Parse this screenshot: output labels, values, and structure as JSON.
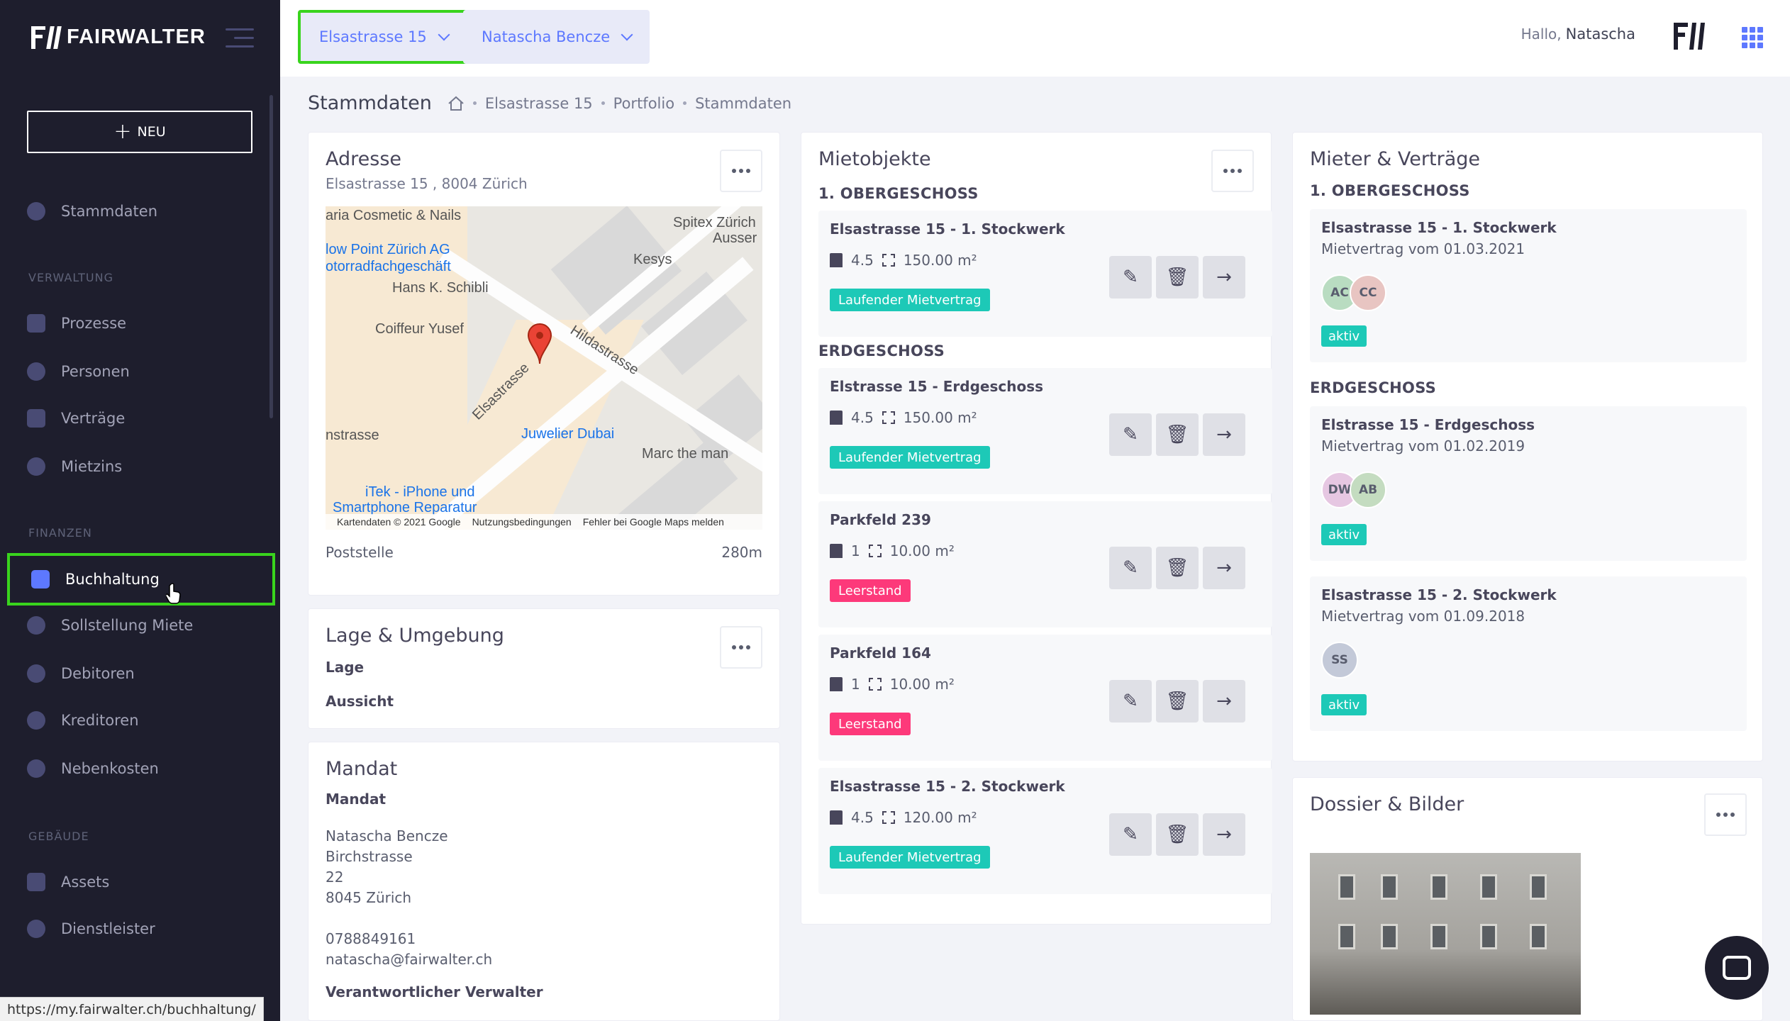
{
  "brand": "FAIRWALTER",
  "sidebar": {
    "new_label": "NEU",
    "top_item": "Stammdaten",
    "sections": [
      {
        "label": "VERWALTUNG",
        "items": [
          "Prozesse",
          "Personen",
          "Verträge",
          "Mietzins"
        ]
      },
      {
        "label": "FINANZEN",
        "items": [
          "Buchhaltung",
          "Sollstellung Miete",
          "Debitoren",
          "Kreditoren",
          "Nebenkosten"
        ]
      },
      {
        "label": "GEBÄUDE",
        "items": [
          "Assets",
          "Dienstleister"
        ]
      }
    ],
    "active_item": "Buchhaltung"
  },
  "status_url": "https://my.fairwalter.ch/buchhaltung/",
  "topbar": {
    "property_select": "Elsastrasse 15",
    "owner_select": "Natascha Bencze",
    "greeting": "Hallo,",
    "user_name": "Natascha"
  },
  "subheader": {
    "title": "Stammdaten",
    "breadcrumb": [
      "Elsastrasse 15",
      "Portfolio",
      "Stammdaten"
    ]
  },
  "adresse": {
    "title": "Adresse",
    "address": "Elsastrasse 15 , 8004 Zürich",
    "map": {
      "labels": [
        "aria Cosmetic & Nails",
        "low Point Zürich AG",
        "otorradfachgeschäft",
        "Hans K. Schibli",
        "Coiffeur Yusef",
        "Spitex Zürich",
        "Ausser",
        "Kesys",
        "Hildastrasse",
        "Elsastrasse",
        "nstrasse",
        "Juwelier Dubai",
        "Marc the man",
        "iTek - iPhone und",
        "Smartphone Reparatur"
      ],
      "footer": [
        "Kartendaten © 2021 Google",
        "Nutzungsbedingungen",
        "Fehler bei Google Maps melden"
      ]
    },
    "poi_label": "Poststelle",
    "poi_distance": "280m"
  },
  "lage": {
    "title": "Lage & Umgebung",
    "lage_label": "Lage",
    "aussicht_label": "Aussicht"
  },
  "mandat": {
    "title": "Mandat",
    "sub": "Mandat",
    "name": "Natascha Bencze",
    "street": "Birchstrasse",
    "number": "22",
    "city": "8045 Zürich",
    "phone": "0788849161",
    "email": "natascha@fairwalter.ch",
    "verwalter_label": "Verantwortlicher Verwalter"
  },
  "mietobjekte": {
    "title": "Mietobjekte",
    "floor1": "1. OBERGESCHOSS",
    "floor0": "ERDGESCHOSS",
    "units": [
      {
        "name": "Elsastrasse 15 - 1. Stockwerk",
        "rooms": "4.5",
        "area": "150.00 m²",
        "status": "Laufender Mietvertrag"
      },
      {
        "name": "Elstrasse 15 - Erdgeschoss",
        "rooms": "4.5",
        "area": "150.00 m²",
        "status": "Laufender Mietvertrag"
      },
      {
        "name": "Parkfeld 239",
        "rooms": "1",
        "area": "10.00 m²",
        "status": "Leerstand"
      },
      {
        "name": "Parkfeld 164",
        "rooms": "1",
        "area": "10.00 m²",
        "status": "Leerstand"
      },
      {
        "name": "Elsastrasse 15 - 2. Stockwerk",
        "rooms": "4.5",
        "area": "120.00 m²",
        "status": "Laufender Mietvertrag"
      }
    ]
  },
  "mieter": {
    "title": "Mieter & Verträge",
    "floor1": "1. OBERGESCHOSS",
    "floor0": "ERDGESCHOSS",
    "contracts": [
      {
        "name": "Elsastrasse 15 - 1. Stockwerk",
        "sub": "Mietvertrag vom 01.03.2021",
        "avatars": [
          "AC",
          "CC"
        ],
        "status": "aktiv"
      },
      {
        "name": "Elstrasse 15 - Erdgeschoss",
        "sub": "Mietvertrag vom 01.02.2019",
        "avatars": [
          "DW",
          "AB"
        ],
        "status": "aktiv"
      },
      {
        "name": "Elsastrasse 15 - 2. Stockwerk",
        "sub": "Mietvertrag vom 01.09.2018",
        "avatars": [
          "SS"
        ],
        "status": "aktiv"
      }
    ]
  },
  "dossier": {
    "title": "Dossier & Bilder"
  },
  "colors": {
    "accent": "#5d78ff",
    "sidebar": "#1e1e2d",
    "success": "#1dc9b7",
    "danger": "#fd397a",
    "highlight": "#39d41d"
  }
}
